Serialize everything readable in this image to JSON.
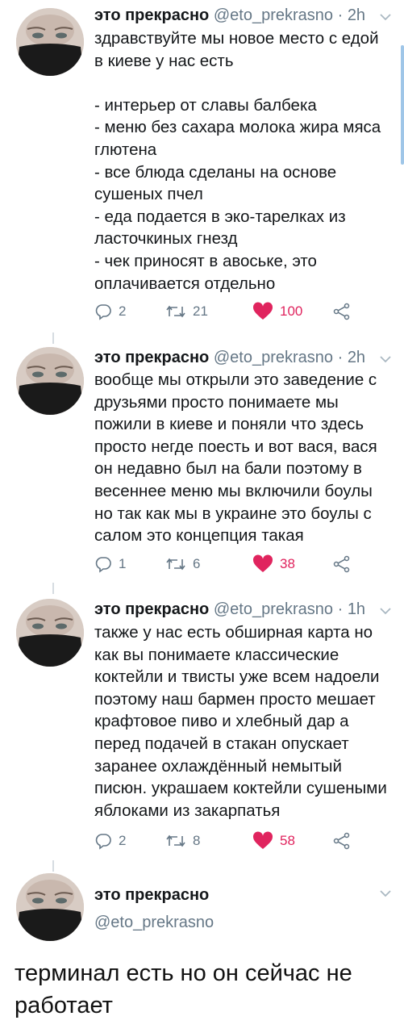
{
  "account": {
    "name": "это прекрасно",
    "handle": "@eto_prekrasno"
  },
  "tweets": [
    {
      "time": "2h",
      "text": "здравствуйте мы новое место с едой\nв киеве у нас есть\n\n- интерьер от славы балбека\n- меню без сахара молока жира мяса\nглютена\n- все блюда сделаны на основе\nсушеных пчел\n- еда подается в эко-тарелках из\nласточкиных гнезд\n- чек приносят в авоське, это\nоплачивается отдельно",
      "replies": "2",
      "retweets": "21",
      "likes": "100"
    },
    {
      "time": "2h",
      "text": "вообще мы открыли это заведение с\nдрузьями просто понимаете мы\nпожили в киеве и поняли что здесь\nпросто негде поесть и вот вася, вася\nон недавно был на бали поэтому в\nвесеннее меню мы включили боулы\nно так как мы в украине это боулы с\nсалом это концепция такая",
      "replies": "1",
      "retweets": "6",
      "likes": "38"
    },
    {
      "time": "1h",
      "text": "также у нас есть обширная карта но\nкак вы понимаете классические\nкоктейли и твисты уже всем надоели\nпоэтому наш бармен просто мешает\nкрафтовое пиво и хлебный дар а\nперед подачей в стакан опускает\nзаранее охлаждённый немытый\nписюн. украшаем коктейли сушеными\nяблоками из закарпатья",
      "replies": "2",
      "retweets": "8",
      "likes": "58"
    }
  ],
  "final_tweet": {
    "text": "терминал есть но он сейчас не работает"
  },
  "colors": {
    "like": "#e0245e",
    "secondary": "#657786",
    "thread_line": "#d6dce1"
  },
  "icons": [
    "reply-icon",
    "retweet-icon",
    "heart-icon",
    "share-icon",
    "chevron-down-icon"
  ]
}
